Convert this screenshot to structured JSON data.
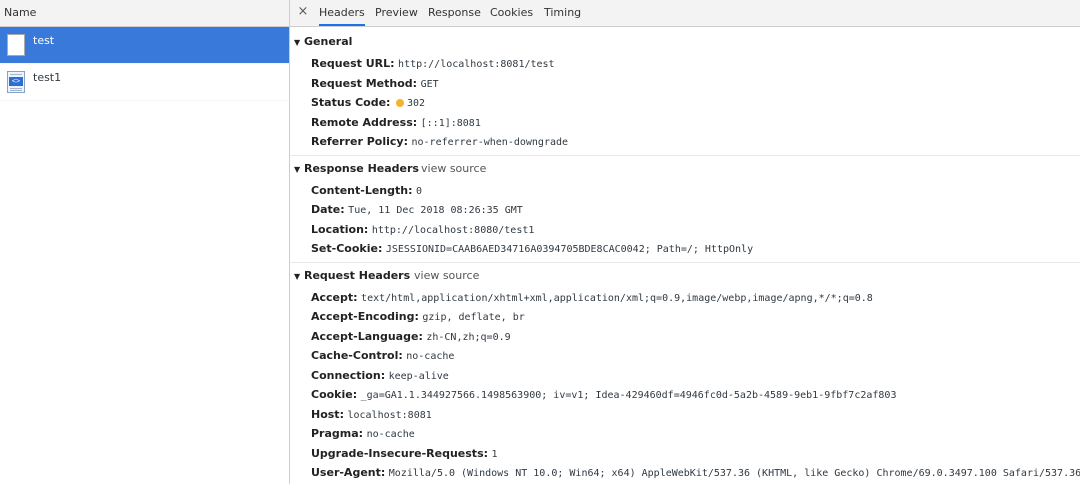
{
  "left": {
    "header": "Name",
    "requests": [
      {
        "name": "test",
        "selected": true
      },
      {
        "name": "test1",
        "selected": false,
        "icon_tag": "<>"
      }
    ]
  },
  "tabs": {
    "close": "×",
    "items": [
      "Headers",
      "Preview",
      "Response",
      "Cookies",
      "Timing"
    ],
    "active": "Headers"
  },
  "general": {
    "title": "General",
    "rows": [
      {
        "k": "Request URL:",
        "v": "http://localhost:8081/test"
      },
      {
        "k": "Request Method:",
        "v": "GET"
      },
      {
        "k": "Status Code:",
        "v": "302"
      },
      {
        "k": "Remote Address:",
        "v": "[::1]:8081"
      },
      {
        "k": "Referrer Policy:",
        "v": "no-referrer-when-downgrade"
      }
    ]
  },
  "response_headers": {
    "title": "Response Headers",
    "view_source": "view source",
    "rows": [
      {
        "k": "Content-Length:",
        "v": "0"
      },
      {
        "k": "Date:",
        "v": "Tue, 11 Dec 2018 08:26:35 GMT"
      },
      {
        "k": "Location:",
        "v": "http://localhost:8080/test1"
      },
      {
        "k": "Set-Cookie:",
        "v": "JSESSIONID=CAAB6AED34716A0394705BDE8CAC0042; Path=/; HttpOnly"
      }
    ]
  },
  "request_headers": {
    "title": "Request Headers",
    "view_source": "view source",
    "rows": [
      {
        "k": "Accept:",
        "v": "text/html,application/xhtml+xml,application/xml;q=0.9,image/webp,image/apng,*/*;q=0.8"
      },
      {
        "k": "Accept-Encoding:",
        "v": "gzip, deflate, br"
      },
      {
        "k": "Accept-Language:",
        "v": "zh-CN,zh;q=0.9"
      },
      {
        "k": "Cache-Control:",
        "v": "no-cache"
      },
      {
        "k": "Connection:",
        "v": "keep-alive"
      },
      {
        "k": "Cookie:",
        "v": "_ga=GA1.1.344927566.1498563900; iv=v1; Idea-429460df=4946fc0d-5a2b-4589-9eb1-9fbf7c2af803"
      },
      {
        "k": "Host:",
        "v": "localhost:8081"
      },
      {
        "k": "Pragma:",
        "v": "no-cache"
      },
      {
        "k": "Upgrade-Insecure-Requests:",
        "v": "1"
      },
      {
        "k": "User-Agent:",
        "v": "Mozilla/5.0 (Windows NT 10.0; Win64; x64) AppleWebKit/537.36 (KHTML, like Gecko) Chrome/69.0.3497.100 Safari/537.36"
      }
    ]
  },
  "colors": {
    "selected_row": "#3879d9",
    "status_dot": "#f7b12d",
    "active_tab_underline": "#1a73e8"
  }
}
